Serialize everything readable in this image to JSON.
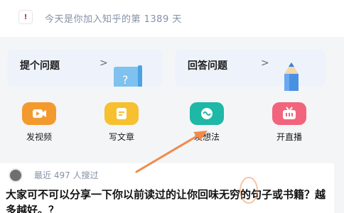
{
  "greeting": {
    "avatar_glyph": "!",
    "text": "今天是你加入知乎的第 1389 天"
  },
  "cards": {
    "ask": {
      "label": "提个问题",
      "arrow": ">"
    },
    "answer": {
      "label": "回答问题",
      "arrow": ">"
    }
  },
  "quick_actions": [
    {
      "label": "发视频",
      "icon": "video-icon",
      "color": "#f39a2e"
    },
    {
      "label": "写文章",
      "icon": "article-icon",
      "color": "#f6c030"
    },
    {
      "label": "发想法",
      "icon": "idea-icon",
      "color": "#1fb7a6"
    },
    {
      "label": "开直播",
      "icon": "live-icon",
      "color": "#f2647c"
    }
  ],
  "feed": {
    "meta": "最近 497 人搜过",
    "title": "大家可不可以分享一下你以前读过的让你回味无穷的句子或书籍？越多越好。？"
  },
  "annotation": {
    "arrow_color": "#f08a4b"
  }
}
